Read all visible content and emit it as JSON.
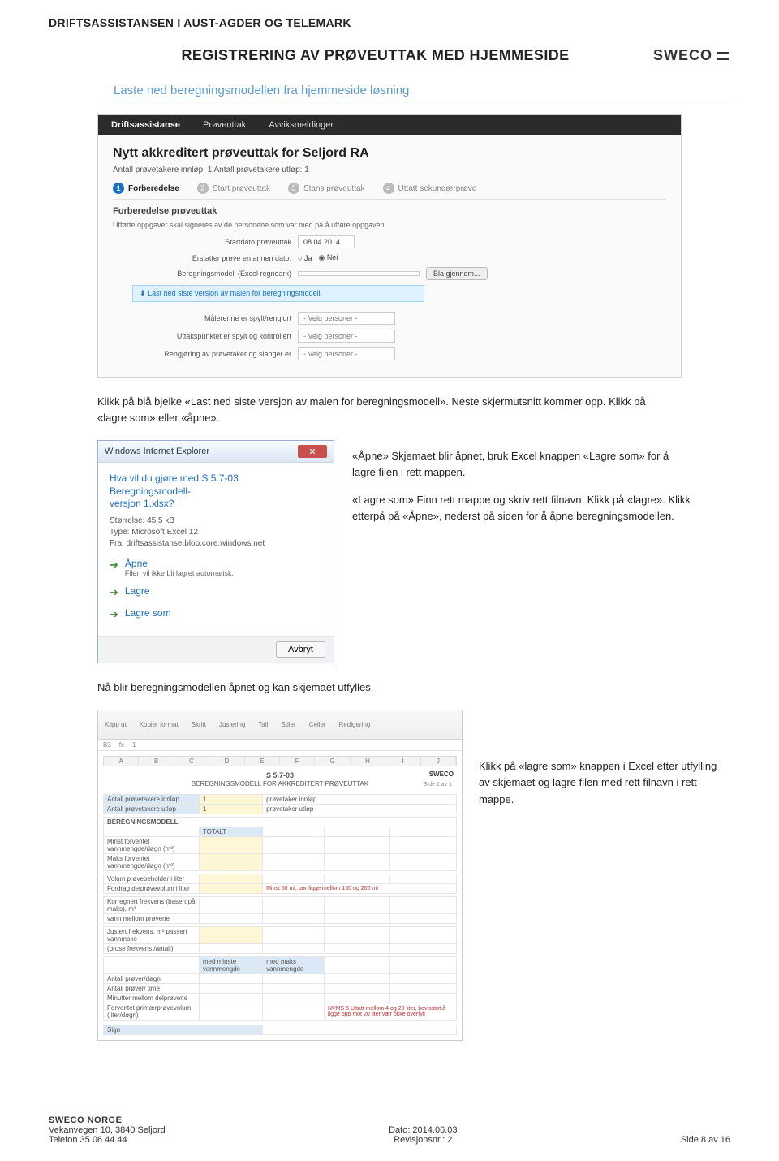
{
  "header": {
    "org": "DRIFTSASSISTANSEN I AUST-AGDER OG TELEMARK",
    "title": "REGISTRERING AV PRØVEUTTAK MED HJEMMESIDE",
    "logo": "SWECO"
  },
  "section_heading": "Laste ned beregningsmodellen fra hjemmeside løsning",
  "screenshot1": {
    "nav": {
      "brand": "Driftsassistanse",
      "item1": "Prøveuttak",
      "item2": "Avviksmeldinger"
    },
    "page_title": "Nytt akkreditert prøveuttak for Seljord RA",
    "subline": "Antall prøvetakere innløp: 1    Antall prøvetakere utløp: 1",
    "steps": {
      "s1": "Forberedelse",
      "s2": "Start prøveuttak",
      "s3": "Stans prøveuttak",
      "s4": "Uttatt sekundærprøve"
    },
    "section": "Forberedelse prøveuttak",
    "desc": "Utførte oppgaver skal signeres av de personene som var med på å utføre oppgaven.",
    "start_label": "Startdato prøveuttak",
    "start_value": "08.04.2014",
    "replace_label": "Erstatter prøve en annen dato:",
    "ja": "Ja",
    "nei": "Nei",
    "model_label": "Beregningsmodell (Excel regneark)",
    "browse": "Bla gjennom...",
    "download": "Last ned siste versjon av malen for beregningsmodell.",
    "row1": "Målerenne er spylt/rengjort",
    "row2": "Uttakspunktet er spylt og kontrollert",
    "row3": "Rengjøring av prøvetaker og slanger er",
    "select_placeholder": "- Velg personer -"
  },
  "para1": "Klikk på blå bjelke «Last ned siste versjon av malen for beregningsmodell». Neste skjermutsnitt kommer opp. Klikk på «lagre som» eller «åpne».",
  "dialog": {
    "titlebar": "Windows Internet Explorer",
    "question_l1": "Hva vil du gjøre med S 5.7-03 Beregningsmodell-",
    "question_l2": "versjon 1.xlsx?",
    "size": "Størrelse: 45,5 kB",
    "type": "Type: Microsoft Excel 12",
    "from": "Fra: driftsassistanse.blob.core.windows.net",
    "open": "Åpne",
    "open_sub": "Filen vil ikke bli lagret automatisk.",
    "save": "Lagre",
    "save_as": "Lagre som",
    "cancel": "Avbryt"
  },
  "right_text": {
    "p1": "«Åpne» Skjemaet blir åpnet, bruk Excel knappen «Lagre som» for å lagre filen i rett mappen.",
    "p2": "«Lagre som» Finn rett mappe og skriv rett filnavn. Klikk på «lagre». Klikk etterpå på «Åpne», nederst på siden for å åpne beregningsmodellen."
  },
  "para2": "Nå blir beregningsmodellen åpnet og kan skjemaet utfylles.",
  "excel": {
    "ribbon": {
      "a": "Klipp ut",
      "b": "Kopier format",
      "c": "Skrift",
      "d": "Justering",
      "e": "Tall",
      "f": "Stiler",
      "g": "Celler",
      "h": "Redigering"
    },
    "cell_ref": "B3",
    "fx": "1",
    "cols": [
      "A",
      "B",
      "C",
      "D",
      "E",
      "F",
      "G",
      "H",
      "I",
      "J"
    ],
    "title1": "S 5.7-03",
    "title2": "BEREGNINGSMODELL FOR AKKREDITERT PRØVEUTTAK",
    "logo": "SWECO",
    "page": "Side 1 av 1",
    "r_in_label": "Antall prøvetakere innløp",
    "r_in_val": "1",
    "r_in_unit": "prøvetaker innløp",
    "r_out_label": "Antall prøvetakere utløp",
    "r_out_val": "1",
    "r_out_unit": "prøvetaker utløp",
    "model_header": "BEREGNINGSMODELL",
    "totalt": "TOTALT",
    "min_label": "Minst forventet vannmengde/døgn    (m³)",
    "max_label": "Maks forventet vannmengde/døgn    (m³)",
    "vol_label": "Volum prøvebeholder i liter",
    "del_label": "Fordrag delprøvevolum i liter",
    "note1": "Minst 50 ml, bør ligge mellom 100 og 200 ml",
    "korr_label": "Korregnert frekvens (basert på maks), m³",
    "vann_label": "vann mellom prøvene",
    "just_label": "Justert frekvens, m³ passert vannmake",
    "pros_label": "(prose frekvens /antall)",
    "min_h": "med minste vannmengde",
    "max_h": "med maks vannmengde",
    "antd": "Antall prøver/døgn",
    "antp": "Antall prøver/ time",
    "minm": "Minutter mellom delprøvene",
    "forv": "Forventet primærprøvevolum (liter/døgn)",
    "note2": "NVMS 5   Uttatt mellom 4 og 20 liter, bevisstøt å ligge opp mot 20 liter vær okke overfyll"
  },
  "right_text2": "Klikk på «lagre som» knappen i Excel etter utfylling av skjemaet og lagre filen med rett filnavn i rett mappe.",
  "footer": {
    "company": "SWECO NORGE",
    "addr": "Vekanvegen 10, 3840 Seljord",
    "tel": "Telefon 35 06 44 44",
    "date": "Dato: 2014.06.03",
    "rev": "Revisjonsnr.: 2",
    "page": "Side 8 av 16"
  }
}
